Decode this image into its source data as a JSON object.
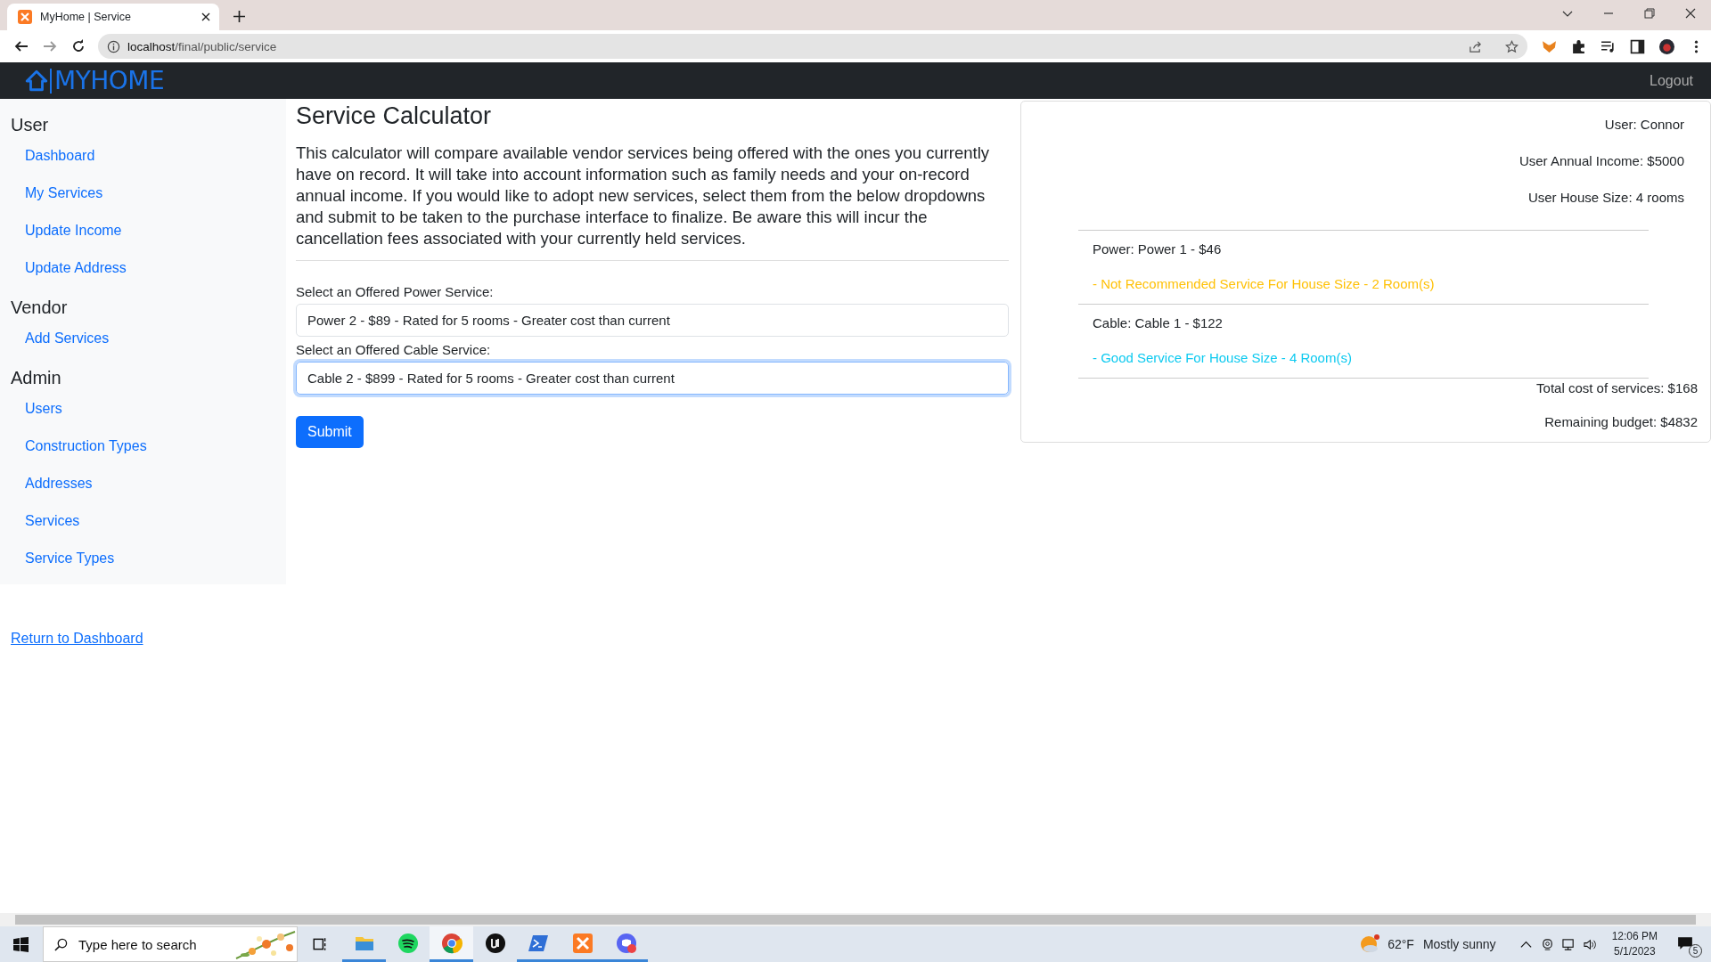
{
  "browser": {
    "tab_title": "MyHome | Service",
    "url_host": "localhost",
    "url_path": "/final/public/service"
  },
  "navbar": {
    "brand": "MYHOME",
    "logout": "Logout"
  },
  "sidebar": [
    {
      "title": "User",
      "items": [
        "Dashboard",
        "My Services",
        "Update Income",
        "Update Address"
      ]
    },
    {
      "title": "Vendor",
      "items": [
        "Add Services"
      ]
    },
    {
      "title": "Admin",
      "items": [
        "Users",
        "Construction Types",
        "Addresses",
        "Services",
        "Service Types"
      ]
    }
  ],
  "return_link": "Return to Dashboard",
  "main": {
    "title": "Service Calculator",
    "description": "This calculator will compare available vendor services being offered with the ones you currently have on record. It will take into account information such as family needs and your on-record annual income. If you would like to adopt new services, select them from the below dropdowns and submit to be taken to the purchase interface to finalize. Be aware this will incur the cancellation fees associated with your currently held services.",
    "selects": [
      {
        "label": "Select an Offered Power Service:",
        "value": "Power 2 - $89 - Rated for 5 rooms - Greater cost than current",
        "focused": false
      },
      {
        "label": "Select an Offered Cable Service:",
        "value": "Cable 2 - $899 - Rated for 5 rooms - Greater cost than current",
        "focused": true
      }
    ],
    "submit": "Submit"
  },
  "summary": {
    "user": "User: Connor",
    "income": "User Annual Income: $5000",
    "house_size": "User House Size: 4 rooms",
    "services": [
      {
        "heading": "Power: Power 1 - $46",
        "note": "- Not Recommended Service For House Size - 2 Room(s)",
        "kind": "warning"
      },
      {
        "heading": "Cable: Cable 1 - $122",
        "note": "- Good Service For House Size - 4 Room(s)",
        "kind": "good"
      }
    ],
    "total": "Total cost of services: $168",
    "remaining": "Remaining budget: $4832"
  },
  "taskbar": {
    "search_placeholder": "Type here to search",
    "apps": [
      {
        "kind": "folder",
        "running": true,
        "selected": false
      },
      {
        "kind": "spotify",
        "running": false,
        "selected": false
      },
      {
        "kind": "chrome",
        "running": true,
        "selected": true
      },
      {
        "kind": "unreal",
        "running": false,
        "selected": false
      },
      {
        "kind": "terminal",
        "running": true,
        "selected": false
      },
      {
        "kind": "xampp",
        "running": true,
        "selected": false
      },
      {
        "kind": "discord",
        "running": true,
        "selected": false
      }
    ],
    "temperature": "62°F",
    "weather": "Mostly sunny",
    "time": "12:06 PM",
    "date": "5/1/2023",
    "notifications": "5"
  }
}
